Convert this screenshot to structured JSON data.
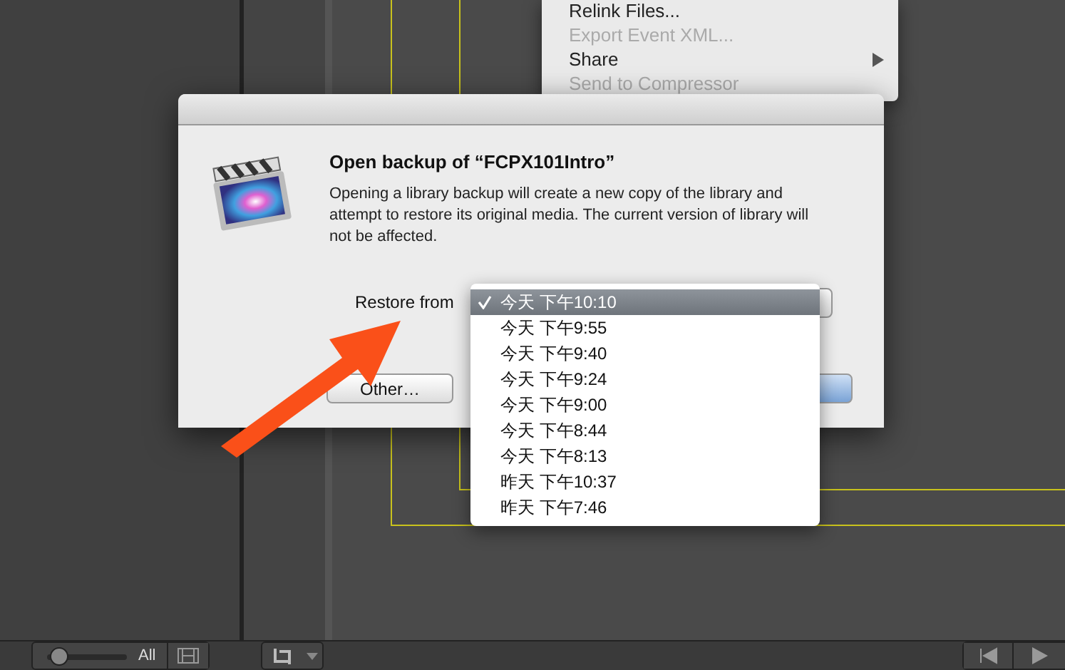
{
  "app_menu": {
    "items": [
      {
        "label": "Relink Files...",
        "disabled": false,
        "submenu": false
      },
      {
        "label": "Export Event XML...",
        "disabled": true,
        "submenu": false
      },
      {
        "label": "Share",
        "disabled": false,
        "submenu": true
      },
      {
        "label": "Send to Compressor",
        "disabled": true,
        "submenu": false
      }
    ]
  },
  "dialog": {
    "title": "Open backup of “FCPX101Intro”",
    "message": "Opening a library backup will create a new copy of the library and attempt to restore its original media. The current version of library will not be affected.",
    "restore_label": "Restore from",
    "other_button": "Other…",
    "backups": [
      {
        "label": "今天 下午10:10",
        "selected": true
      },
      {
        "label": "今天 下午9:55",
        "selected": false
      },
      {
        "label": "今天 下午9:40",
        "selected": false
      },
      {
        "label": "今天 下午9:24",
        "selected": false
      },
      {
        "label": "今天 下午9:00",
        "selected": false
      },
      {
        "label": "今天 下午8:44",
        "selected": false
      },
      {
        "label": "今天 下午8:13",
        "selected": false
      },
      {
        "label": "昨天 下午10:37",
        "selected": false
      },
      {
        "label": "昨天 下午7:46",
        "selected": false
      }
    ]
  },
  "toolbar": {
    "zoom": {
      "level": 0.05
    },
    "filter": "All"
  }
}
